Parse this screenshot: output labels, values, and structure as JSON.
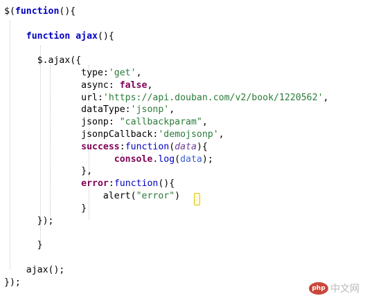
{
  "code_lines": [
    [
      {
        "t": "$(",
        "c": "plain"
      },
      {
        "t": "function",
        "c": "kw"
      },
      {
        "t": "(){",
        "c": "plain"
      }
    ],
    [],
    [
      {
        "t": "    ",
        "c": "plain"
      },
      {
        "t": "function",
        "c": "kw"
      },
      {
        "t": " ajax",
        "c": "kw"
      },
      {
        "t": "(){",
        "c": "plain"
      }
    ],
    [],
    [
      {
        "t": "      $.ajax({",
        "c": "plain"
      }
    ],
    [
      {
        "t": "              type:",
        "c": "plain"
      },
      {
        "t": "'get'",
        "c": "str"
      },
      {
        "t": ",",
        "c": "plain"
      }
    ],
    [
      {
        "t": "              async: ",
        "c": "plain"
      },
      {
        "t": "false",
        "c": "bool"
      },
      {
        "t": ",",
        "c": "plain"
      }
    ],
    [
      {
        "t": "              url:",
        "c": "plain"
      },
      {
        "t": "'https://api.douban.com/v2/book/1220562'",
        "c": "str"
      },
      {
        "t": ",",
        "c": "plain"
      }
    ],
    [
      {
        "t": "              dataType:",
        "c": "plain"
      },
      {
        "t": "'jsonp'",
        "c": "str"
      },
      {
        "t": ",",
        "c": "plain"
      }
    ],
    [
      {
        "t": "              jsonp: ",
        "c": "plain"
      },
      {
        "t": "\"callbackparam\"",
        "c": "str"
      },
      {
        "t": ",",
        "c": "plain"
      }
    ],
    [
      {
        "t": "              jsonpCallback:",
        "c": "plain"
      },
      {
        "t": "'demojsonp'",
        "c": "str"
      },
      {
        "t": ",",
        "c": "plain"
      }
    ],
    [
      {
        "t": "              ",
        "c": "plain"
      },
      {
        "t": "success",
        "c": "member"
      },
      {
        "t": ":",
        "c": "plain"
      },
      {
        "t": "function",
        "c": "kw2"
      },
      {
        "t": "(",
        "c": "plain"
      },
      {
        "t": "data",
        "c": "ital"
      },
      {
        "t": "){",
        "c": "plain"
      }
    ],
    [
      {
        "t": "                    ",
        "c": "plain"
      },
      {
        "t": "console",
        "c": "member"
      },
      {
        "t": ".",
        "c": "plain"
      },
      {
        "t": "log",
        "c": "fn"
      },
      {
        "t": "(",
        "c": "plain"
      },
      {
        "t": "data",
        "c": "member2"
      },
      {
        "t": ");",
        "c": "plain"
      }
    ],
    [
      {
        "t": "              },",
        "c": "plain"
      }
    ],
    [
      {
        "t": "              ",
        "c": "plain"
      },
      {
        "t": "error",
        "c": "member"
      },
      {
        "t": ":",
        "c": "plain"
      },
      {
        "t": "function",
        "c": "kw2"
      },
      {
        "t": "(){",
        "c": "plain"
      }
    ],
    [
      {
        "t": "                  alert(",
        "c": "plain"
      },
      {
        "t": "\"error\"",
        "c": "str"
      },
      {
        "t": ")",
        "c": "plain"
      }
    ],
    [
      {
        "t": "              }",
        "c": "plain"
      }
    ],
    [
      {
        "t": "      });",
        "c": "plain"
      }
    ],
    [],
    [
      {
        "t": "      }",
        "c": "plain"
      }
    ],
    [],
    [
      {
        "t": "    ajax();",
        "c": "plain"
      }
    ],
    [
      {
        "t": "});",
        "c": "plain"
      }
    ]
  ],
  "watermark": {
    "logo_text": "php",
    "site_text": "中文网"
  }
}
